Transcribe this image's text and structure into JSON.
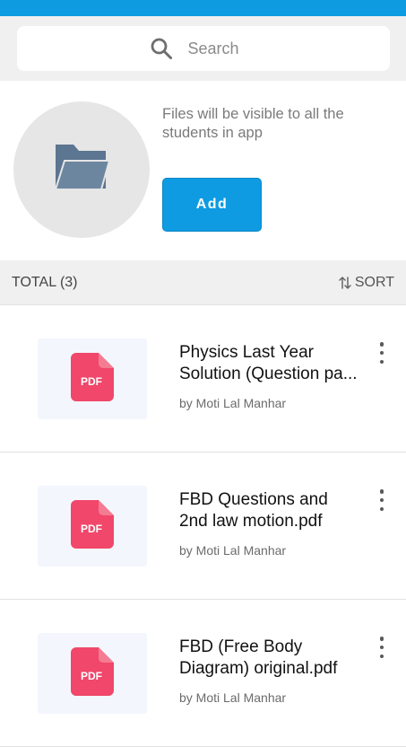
{
  "search": {
    "placeholder": "Search"
  },
  "promo": {
    "text": "Files will be visible to all the students in app",
    "add_label": "Add"
  },
  "list_header": {
    "total_label": "TOTAL (3)",
    "sort_label": "SORT"
  },
  "files": [
    {
      "title_line1": "Physics Last Year",
      "title_line2": "Solution (Question pa...",
      "author": "by Moti Lal Manhar",
      "badge": "PDF"
    },
    {
      "title_line1": "FBD Questions and",
      "title_line2": "2nd law motion.pdf",
      "author": "by Moti Lal Manhar",
      "badge": "PDF"
    },
    {
      "title_line1": "FBD (Free Body",
      "title_line2": "Diagram) original.pdf",
      "author": "by Moti Lal Manhar",
      "badge": "PDF"
    }
  ],
  "colors": {
    "status_bar": "#0f9be0",
    "accent": "#0e9be2",
    "pdf_red": "#f0476a"
  },
  "icons": [
    "search-icon",
    "folder-icon",
    "sort-icon",
    "pdf-file-icon",
    "more-vert-icon"
  ]
}
